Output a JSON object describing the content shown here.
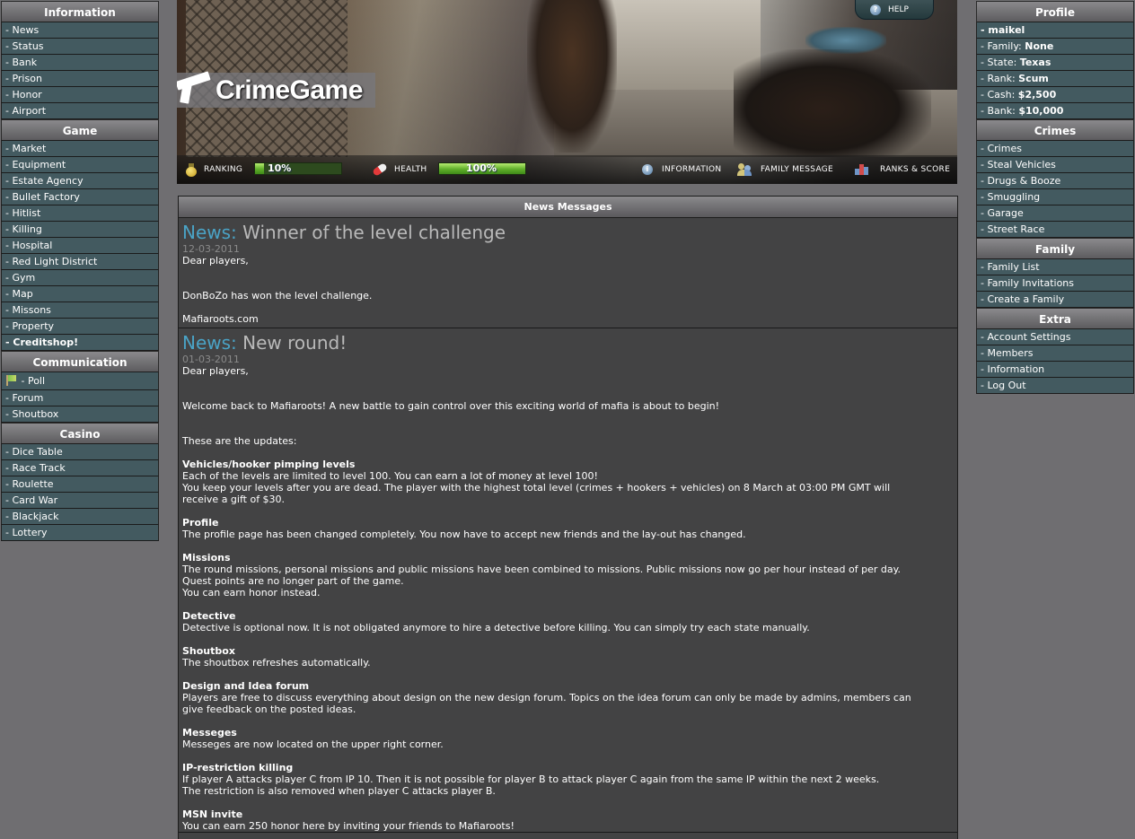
{
  "left_menu": {
    "information": {
      "title": "Information",
      "items": [
        "- News",
        "- Status",
        "- Bank",
        "- Prison",
        "- Honor",
        "- Airport"
      ]
    },
    "game": {
      "title": "Game",
      "items": [
        "- Market",
        "- Equipment",
        "- Estate Agency",
        "- Bullet Factory",
        "- Hitlist",
        "- Killing",
        "- Hospital",
        "- Red Light District",
        "- Gym",
        "- Map",
        "- Missons",
        "- Property",
        "- Creditshop!"
      ]
    },
    "communication": {
      "title": "Communication",
      "items": [
        "- Poll",
        "- Forum",
        "- Shoutbox"
      ]
    },
    "casino": {
      "title": "Casino",
      "items": [
        "- Dice Table",
        "- Race Track",
        "- Roulette",
        "- Card War",
        "- Blackjack",
        "- Lottery"
      ]
    }
  },
  "right_menu": {
    "profile": {
      "title": "Profile",
      "username": "- maikel",
      "stats": [
        {
          "label": "- Family: ",
          "value": "None"
        },
        {
          "label": "- State: ",
          "value": "Texas"
        },
        {
          "label": "- Rank: ",
          "value": "Scum"
        },
        {
          "label": "- Cash: ",
          "value": "$2,500"
        },
        {
          "label": "- Bank: ",
          "value": "$10,000"
        }
      ]
    },
    "crimes": {
      "title": "Crimes",
      "items": [
        "- Crimes",
        "- Steal Vehicles",
        "- Drugs & Booze",
        "- Smuggling",
        "- Garage",
        "- Street Race"
      ]
    },
    "family": {
      "title": "Family",
      "items": [
        "- Family List",
        "- Family Invitations",
        "- Create a Family"
      ]
    },
    "extra": {
      "title": "Extra",
      "items": [
        "- Account Settings",
        "- Members",
        "- Information",
        "- Log Out"
      ]
    }
  },
  "banner": {
    "logo_text": "CrimeGame",
    "help_label": "HELP",
    "ranking_label": "RANKING",
    "ranking_value": "10%",
    "ranking_fraction": 0.1,
    "health_label": "HEALTH",
    "health_value": "100%",
    "health_fraction": 1.0,
    "information_label": "INFORMATION",
    "family_message_label": "FAMILY MESSAGE",
    "ranks_score_label": "RANKS & SCORE"
  },
  "news": {
    "panel_title": "News Messages",
    "items": [
      {
        "prefix": "News:",
        "title": "Winner of the level challenge",
        "date": "12-03-2011",
        "greeting": "Dear players,",
        "body": "DonBoZo has won the level challenge.",
        "footer": "Mafiaroots.com"
      },
      {
        "prefix": "News:",
        "title": "New round!",
        "date": "01-03-2011",
        "greeting": "Dear players,",
        "intro": "Welcome back to Mafiaroots! A new battle to gain control over this exciting world of mafia is about to begin!",
        "updates_intro": "These are the updates:",
        "sections": [
          {
            "heading": "Vehicles/hooker pimping levels",
            "lines": [
              "Each of the levels are limited to level 100. You can earn a lot of money at level 100!",
              "You keep your levels after you are dead. The player with the highest total level (crimes + hookers + vehicles) on 8 March at 03:00 PM GMT will",
              "receive a gift of $30."
            ]
          },
          {
            "heading": "Profile",
            "lines": [
              "The profile page has been changed completely. You now have to accept new friends and the lay-out has changed."
            ]
          },
          {
            "heading": "Missions",
            "lines": [
              "The round missions, personal missions and public missions have been combined to missions. Public missions now go per hour instead of per day.",
              "Quest points are no longer part of the game.",
              "You can earn honor instead."
            ]
          },
          {
            "heading": "Detective",
            "lines": [
              "Detective is optional now. It is not obligated anymore to hire a detective before killing. You can simply try each state manually."
            ]
          },
          {
            "heading": "Shoutbox",
            "lines": [
              "The shoutbox refreshes automatically."
            ]
          },
          {
            "heading": "Design and Idea forum",
            "lines": [
              "Players are free to discuss everything about design on the new design forum. Topics on the idea forum can only be made by admins, members can",
              "give feedback on the posted ideas."
            ]
          },
          {
            "heading": "Messeges",
            "lines": [
              "Messeges are now located on the upper right corner."
            ]
          },
          {
            "heading": "IP-restriction killing",
            "lines": [
              "If player A attacks player C from IP 10. Then it is not possible for player B to attack player C again from the same IP within the next 2 weeks.",
              "The restriction is also removed when player C attacks player B."
            ]
          },
          {
            "heading": "MSN invite",
            "lines": [
              "You can earn 250 honor here by inviting your friends to Mafiaroots!"
            ]
          }
        ]
      }
    ]
  }
}
